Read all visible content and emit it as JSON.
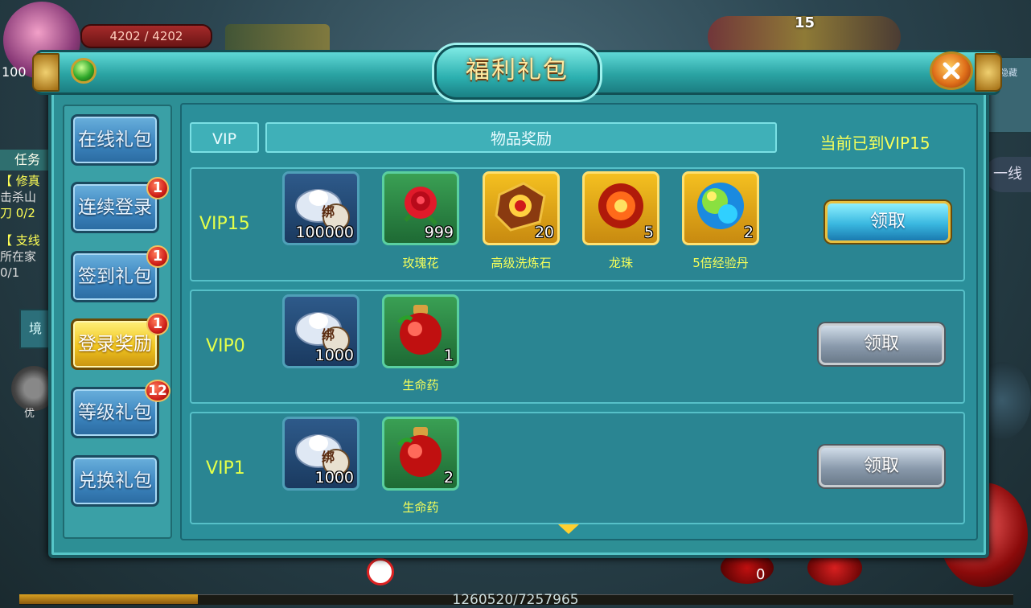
{
  "hud": {
    "hp": "4202 / 4202",
    "level": "100",
    "quest_tab": "任务",
    "quest_lines": [
      {
        "text": "【 修真",
        "color": "yellow"
      },
      {
        "text": "击杀山",
        "color": "white"
      },
      {
        "text": "刀 0/2",
        "color": "yellow"
      },
      {
        "text": "【 支线",
        "color": "yellow"
      },
      {
        "text": "所在家",
        "color": "white"
      },
      {
        "text": "0/1",
        "color": "white"
      }
    ],
    "scene_label": "境",
    "settings_label": "优",
    "count_badge": "15",
    "line_button": "一线",
    "right_tab_label": "隐藏",
    "skill_value": "0",
    "exp": "1260520/7257965",
    "exp_fraction": 0.17
  },
  "dialog": {
    "title": "福利礼包",
    "nav": [
      {
        "label": "在线礼包",
        "badge": "",
        "active": false
      },
      {
        "label": "连续登录",
        "badge": "1",
        "active": false
      },
      {
        "label": "签到礼包",
        "badge": "1",
        "active": false
      },
      {
        "label": "登录奖励",
        "badge": "1",
        "active": true
      },
      {
        "label": "等级礼包",
        "badge": "12",
        "active": false
      },
      {
        "label": "兑换礼包",
        "badge": "",
        "active": false
      }
    ],
    "header": {
      "vip": "VIP",
      "rewards": "物品奖励",
      "current_vip": "当前已到VIP15"
    },
    "rows": [
      {
        "vip": "VIP15",
        "items": [
          {
            "icon": "bound-silver-icon",
            "qty": "100000",
            "name": ""
          },
          {
            "icon": "rose-icon",
            "qty": "999",
            "name": "玫瑰花"
          },
          {
            "icon": "refine-stone-icon",
            "qty": "20",
            "name": "高级洗炼石"
          },
          {
            "icon": "dragon-pearl-icon",
            "qty": "5",
            "name": "龙珠"
          },
          {
            "icon": "exp-pill-icon",
            "qty": "2",
            "name": "5倍经验丹"
          }
        ],
        "button": "领取",
        "claimable": true
      },
      {
        "vip": "VIP0",
        "items": [
          {
            "icon": "bound-silver-icon",
            "qty": "1000",
            "name": ""
          },
          {
            "icon": "health-potion-icon",
            "qty": "1",
            "name": "生命药"
          }
        ],
        "button": "领取",
        "claimable": false
      },
      {
        "vip": "VIP1",
        "items": [
          {
            "icon": "bound-silver-icon",
            "qty": "1000",
            "name": ""
          },
          {
            "icon": "health-potion-icon",
            "qty": "2",
            "name": "生命药"
          }
        ],
        "button": "领取",
        "claimable": false
      }
    ],
    "silver_stamp": "绑",
    "colors": {
      "vip_label": "#e4ff4a",
      "panel": "#2b8f9a",
      "active_tab": "#f0c520"
    }
  }
}
